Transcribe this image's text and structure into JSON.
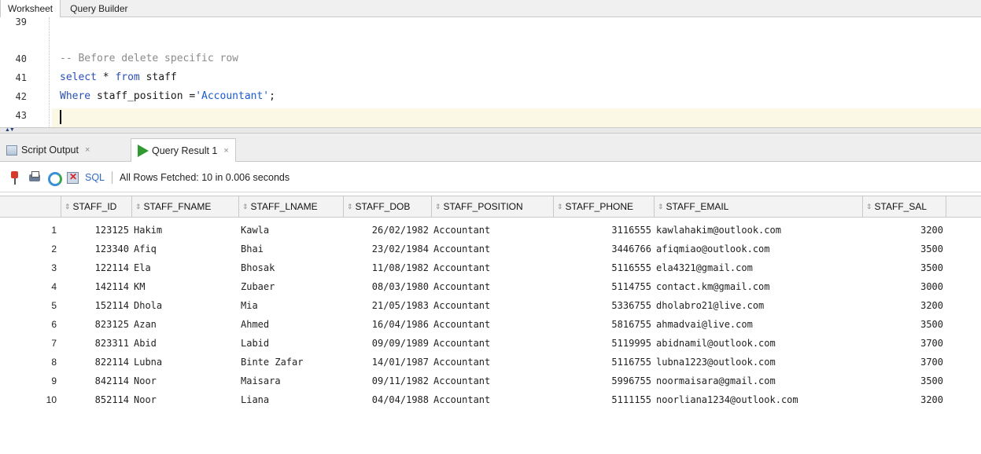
{
  "editor_tabs": [
    "Worksheet",
    "Query Builder"
  ],
  "editor": {
    "line_numbers": [
      "39",
      "40",
      "41",
      "42",
      "43"
    ],
    "code": {
      "comment": "-- Before delete specific row",
      "select_kw": "select",
      "select_rest": " * ",
      "from_kw": "from",
      "from_rest": " staff",
      "where_kw": "Where",
      "where_rest": " staff_position =",
      "where_str": "'Accountant'",
      "where_end": ";"
    }
  },
  "output_tabs": {
    "script_output": "Script Output",
    "query_result": "Query Result 1",
    "close_glyph": "×"
  },
  "toolbar": {
    "sql_label": "SQL",
    "status": "All Rows Fetched: 10 in 0.006 seconds"
  },
  "grid": {
    "sort_glyph": "⇕",
    "columns": [
      "STAFF_ID",
      "STAFF_FNAME",
      "STAFF_LNAME",
      "STAFF_DOB",
      "STAFF_POSITION",
      "STAFF_PHONE",
      "STAFF_EMAIL",
      "STAFF_SAL"
    ],
    "rows": [
      [
        "1",
        "123125",
        "Hakim",
        "Kawla",
        "26/02/1982",
        "Accountant",
        "3116555",
        "kawlahakim@outlook.com",
        "3200"
      ],
      [
        "2",
        "123340",
        "Afiq",
        "Bhai",
        "23/02/1984",
        "Accountant",
        "3446766",
        "afiqmiao@outlook.com",
        "3500"
      ],
      [
        "3",
        "122114",
        "Ela",
        "Bhosak",
        "11/08/1982",
        "Accountant",
        "5116555",
        "ela4321@gmail.com",
        "3500"
      ],
      [
        "4",
        "142114",
        "KM",
        "Zubaer",
        "08/03/1980",
        "Accountant",
        "5114755",
        "contact.km@gmail.com",
        "3000"
      ],
      [
        "5",
        "152114",
        "Dhola",
        "Mia",
        "21/05/1983",
        "Accountant",
        "5336755",
        "dholabro21@live.com",
        "3200"
      ],
      [
        "6",
        "823125",
        "Azan",
        "Ahmed",
        "16/04/1986",
        "Accountant",
        "5816755",
        "ahmadvai@live.com",
        "3500"
      ],
      [
        "7",
        "823311",
        "Abid",
        "Labid",
        "09/09/1989",
        "Accountant",
        "5119995",
        "abidnamil@outlook.com",
        "3700"
      ],
      [
        "8",
        "822114",
        "Lubna",
        "Binte Zafar",
        "14/01/1987",
        "Accountant",
        "5116755",
        "lubna1223@outlook.com",
        "3700"
      ],
      [
        "9",
        "842114",
        "Noor",
        "Maisara",
        "09/11/1982",
        "Accountant",
        "5996755",
        "noormaisara@gmail.com",
        "3500"
      ],
      [
        "10",
        "852114",
        "Noor",
        "Liana",
        "04/04/1988",
        "Accountant",
        "5111155",
        "noorliana1234@outlook.com",
        "3200"
      ]
    ]
  }
}
